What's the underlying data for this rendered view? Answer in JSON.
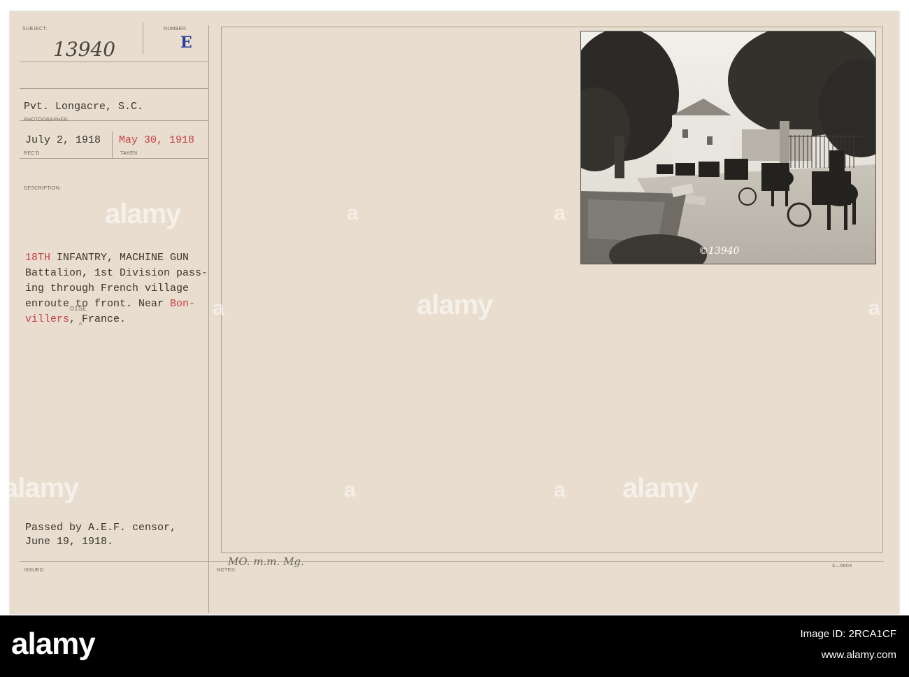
{
  "card": {
    "labels": {
      "subject": "SUBJECT:",
      "number": "NUMBER",
      "photographer": "PHOTOGRAPHER",
      "recd": "REC'D",
      "taken": "TAKEN",
      "description": "DESCRIPTION:",
      "issued": "ISSUED:",
      "notes": "NOTES:",
      "form_no": "3—6603"
    },
    "subject_number": "13940",
    "number_letter": "E",
    "photographer": "Pvt. Longacre, S.C.",
    "received_date": "July 2, 1918",
    "taken_date": "May 30, 1918",
    "description": {
      "line1_red": "18TH",
      "line1_rest": " INFANTRY, MACHINE GUN",
      "line2": "Battalion, 1st Division pass-",
      "line3": "ing through French village",
      "line4": "enroute to front. Near ",
      "line4_red": "Bon-",
      "line5_red": "villers",
      "line5_rest": ", France.",
      "insert": "OISE",
      "caret": "^"
    },
    "censor_line1": "Passed by A.E.F. censor,",
    "censor_line2": "June 19, 1918.",
    "notes_handwriting": "MO. m.m. Mg.",
    "photo_caption": "©13940"
  },
  "watermark": {
    "brand": "alamy",
    "image_id": "2RCA1CF",
    "url": "www.alamy.com"
  },
  "colors": {
    "card": "#e8ddce",
    "red_ink": "#c8404a",
    "blue_stamp": "#2a3f9a",
    "footer": "#000000"
  }
}
